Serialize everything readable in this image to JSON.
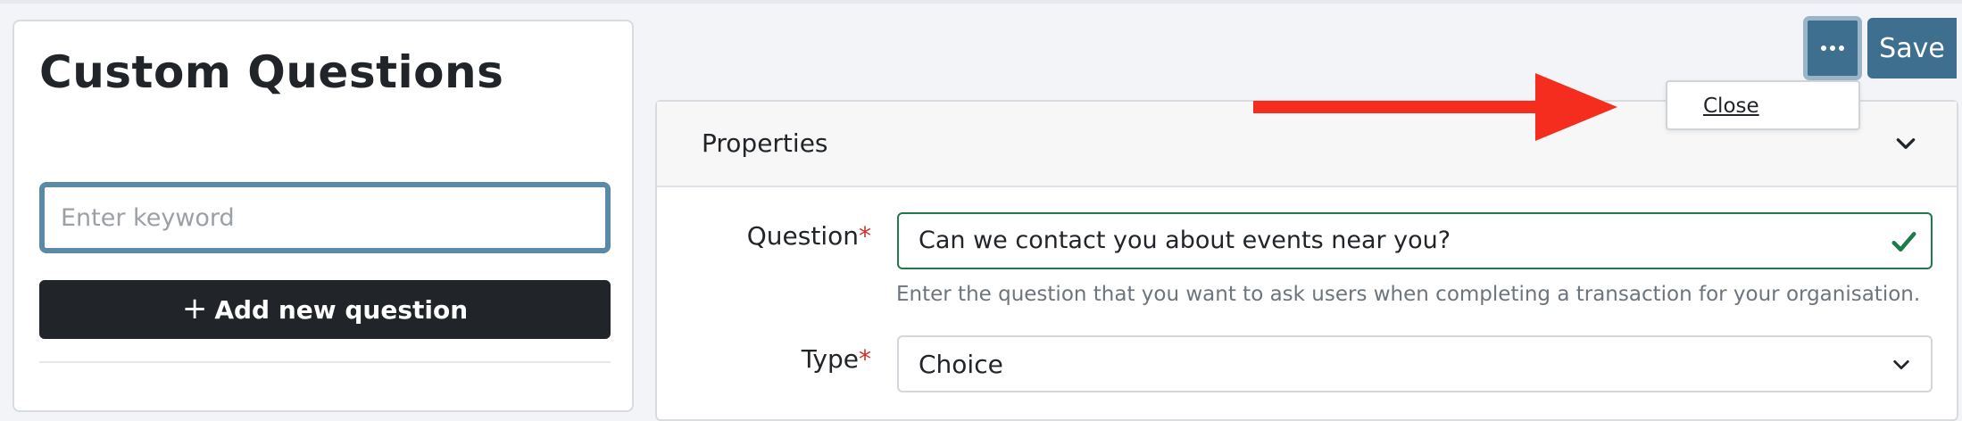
{
  "left_panel": {
    "title": "Custom Questions",
    "search_placeholder": "Enter keyword",
    "add_button_label": "Add new question",
    "add_button_icon": "plus-icon"
  },
  "toolbar": {
    "more_icon": "ellipsis-icon",
    "save_label": "Save",
    "menu": {
      "items": [
        "Close"
      ]
    }
  },
  "properties": {
    "header": "Properties",
    "header_icon": "chevron-down-icon",
    "question": {
      "label": "Question",
      "required_marker": "*",
      "value": "Can we contact you about events near you?",
      "valid_icon": "check-icon",
      "help": "Enter the question that you want to ask users when completing a transaction for your organisation."
    },
    "type": {
      "label": "Type",
      "required_marker": "*",
      "selected": "Choice",
      "icon": "chevron-down-icon"
    }
  },
  "annotation": {
    "arrow_icon": "red-arrow-icon",
    "color": "#f42d1e"
  },
  "colors": {
    "primary": "#3f6f8f",
    "dark_button": "#212529",
    "valid_green": "#1f7a4a",
    "required_red": "#d0302a"
  }
}
